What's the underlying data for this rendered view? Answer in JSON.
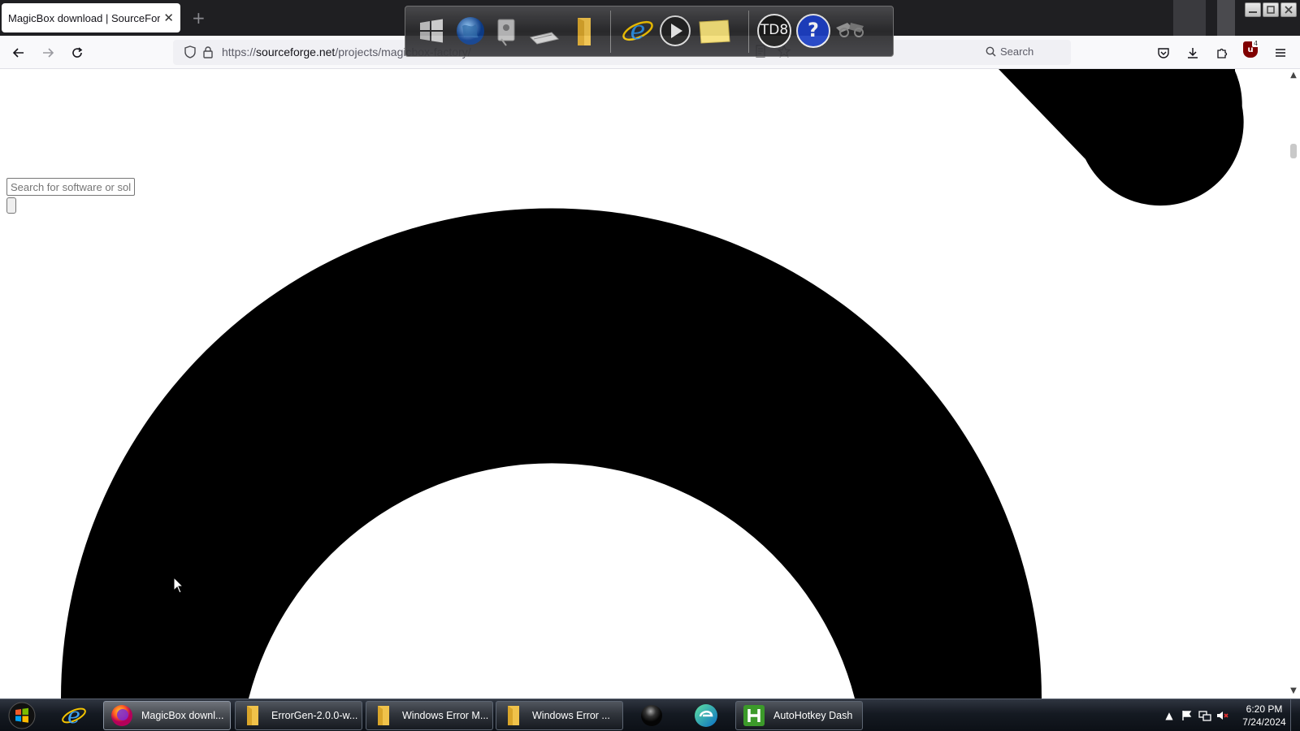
{
  "browser": {
    "tab_title": "MagicBox download | SourceForge.net",
    "tab_close": "✕",
    "new_tab": "+",
    "url_scheme": "https://",
    "url_host": "sourceforge.net",
    "url_path": "/projects/magicbox-factory/",
    "search_label": "Search",
    "ublock_badge": "4"
  },
  "page": {
    "search_placeholder": "Search for software or solutions"
  },
  "dock": {
    "td8_label": "TD8",
    "help_label": "?"
  },
  "taskbar": {
    "tasks": [
      {
        "label": "MagicBox downl..."
      },
      {
        "label": "ErrorGen-2.0.0-w..."
      },
      {
        "label": "Windows Error M..."
      },
      {
        "label": "Windows Error ..."
      },
      {
        "label": "AutoHotkey Dash"
      }
    ],
    "time": "6:20 PM",
    "date": "7/24/2024"
  }
}
